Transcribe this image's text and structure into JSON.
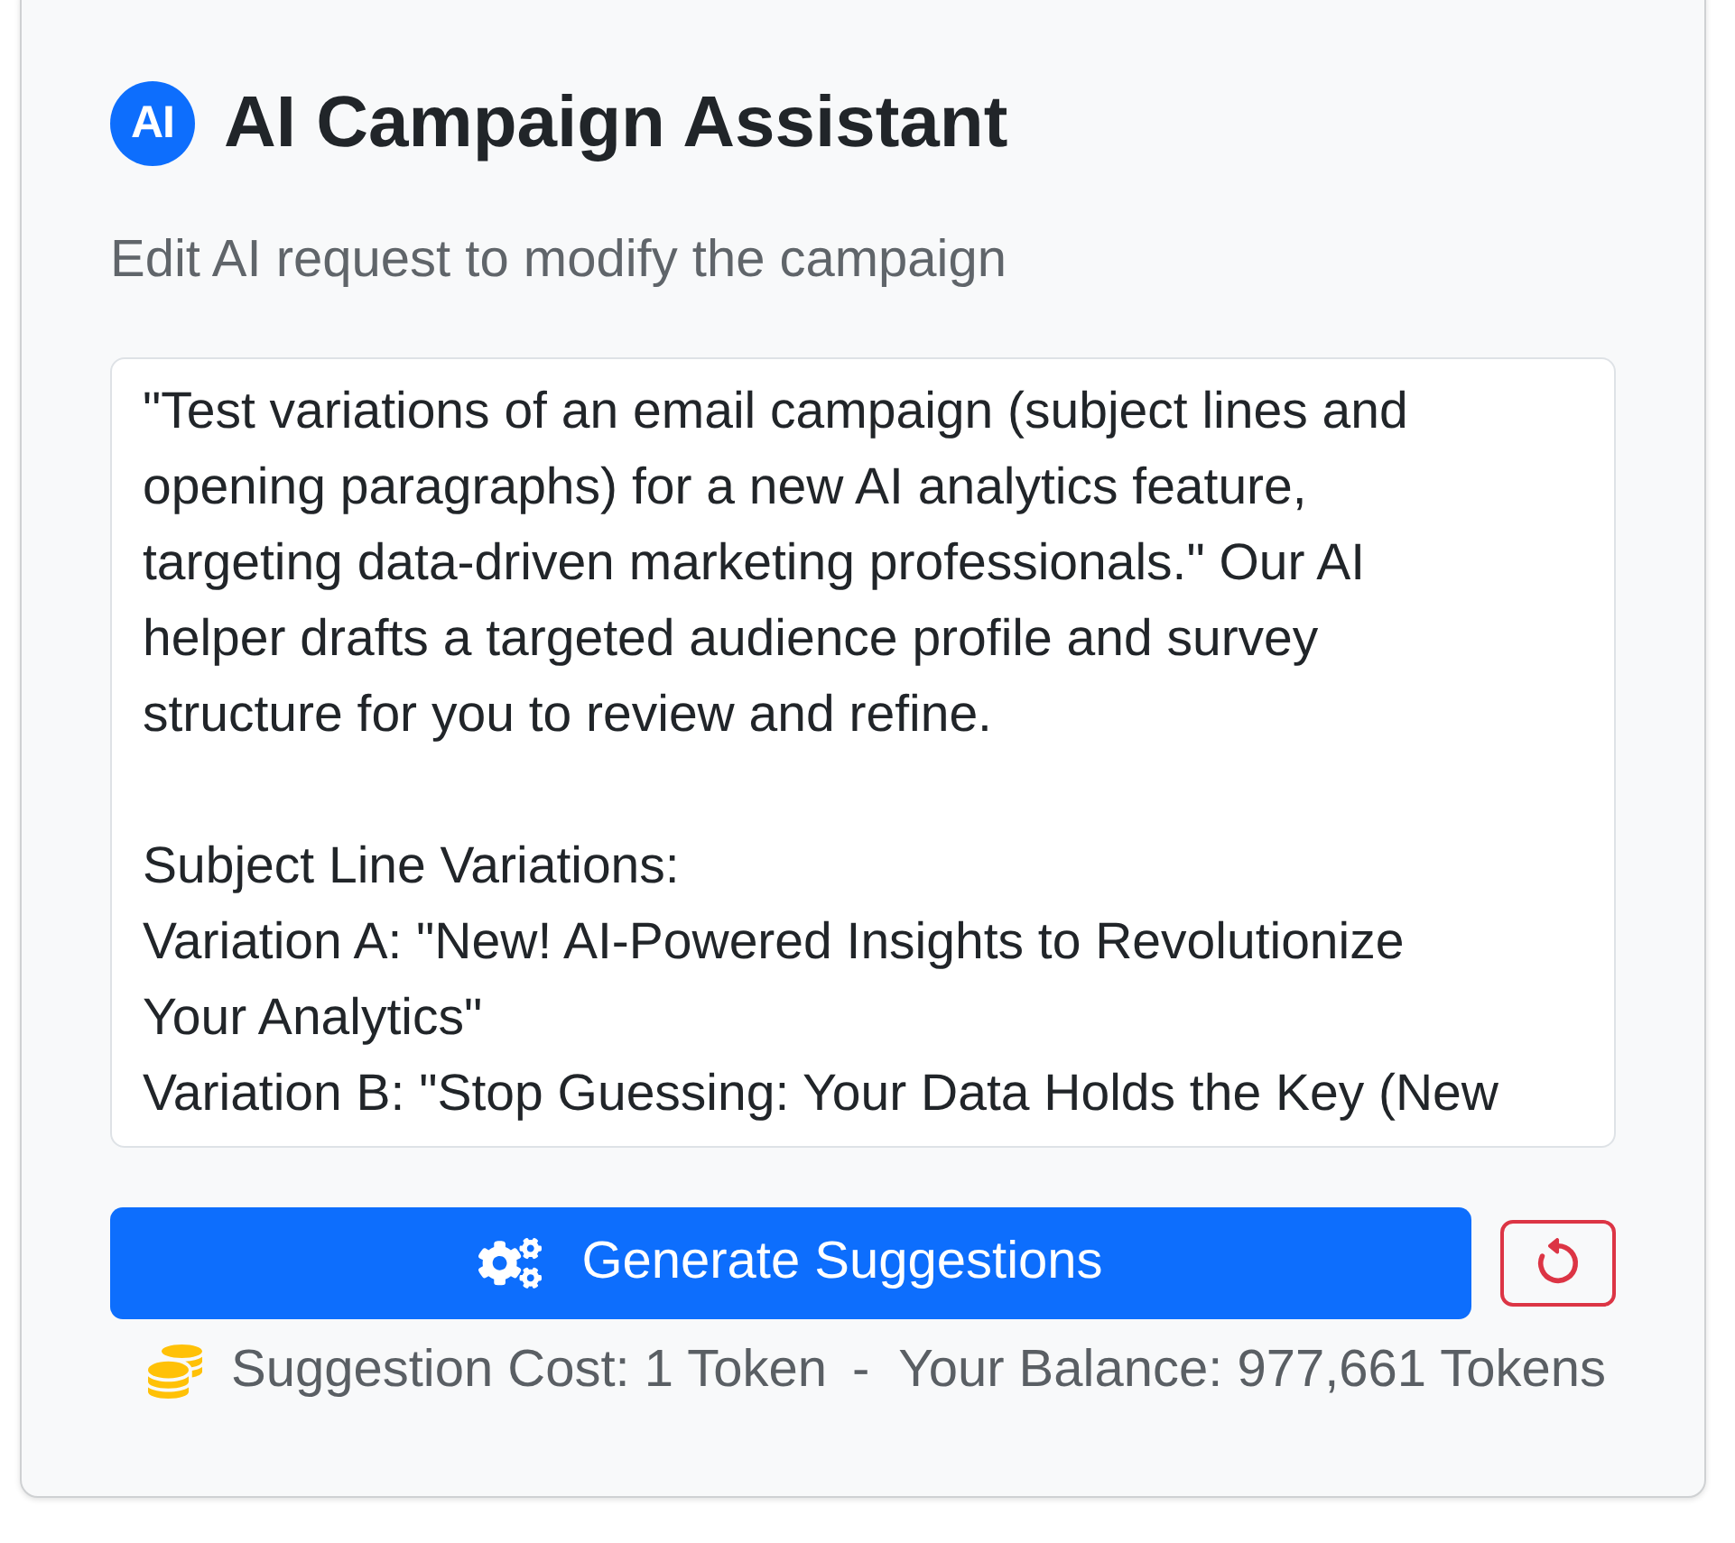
{
  "header": {
    "badge": "AI",
    "title": "AI Campaign Assistant"
  },
  "subtitle": "Edit AI request to modify the campaign",
  "request": {
    "value": "\"Test variations of an email campaign (subject lines and opening paragraphs) for a new AI analytics feature, targeting data-driven marketing professionals.\" Our AI helper drafts a targeted audience profile and survey structure for you to review and refine.\n\nSubject Line Variations:\nVariation A: \"New! AI-Powered Insights to Revolutionize Your Analytics\"\nVariation B: \"Stop Guessing: Your Data Holds the Key (New"
  },
  "actions": {
    "generate": "Generate Suggestions"
  },
  "footer": {
    "cost": "Suggestion Cost: 1 Token",
    "separator": "-",
    "balance": "Your Balance: 977,661 Tokens"
  }
}
